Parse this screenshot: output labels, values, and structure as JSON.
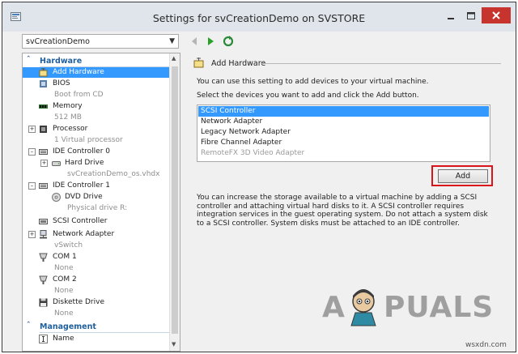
{
  "window": {
    "title": "Settings for svCreationDemo on SVSTORE",
    "icon": "settings-app-icon"
  },
  "toolbar": {
    "vm_selector_value": "svCreationDemo",
    "back_icon": "back-arrow-icon",
    "forward_icon": "play-forward-icon",
    "refresh_icon": "refresh-icon"
  },
  "tree": {
    "hardware_header": "Hardware",
    "management_header": "Management",
    "items": {
      "add_hardware": "Add Hardware",
      "bios": "BIOS",
      "bios_sub": "Boot from CD",
      "memory": "Memory",
      "memory_sub": "512 MB",
      "processor": "Processor",
      "processor_sub": "1 Virtual processor",
      "ide0": "IDE Controller 0",
      "hard_drive": "Hard Drive",
      "hard_drive_sub": "svCreationDemo_os.vhdx",
      "ide1": "IDE Controller 1",
      "dvd_drive": "DVD Drive",
      "dvd_drive_sub": "Physical drive R:",
      "scsi": "SCSI Controller",
      "network": "Network Adapter",
      "network_sub": "vSwitch",
      "com1": "COM 1",
      "com1_sub": "None",
      "com2": "COM 2",
      "com2_sub": "None",
      "diskette": "Diskette Drive",
      "diskette_sub": "None",
      "name": "Name"
    }
  },
  "panel": {
    "title": "Add Hardware",
    "line1": "You can use this setting to add devices to your virtual machine.",
    "line2": "Select the devices you want to add and click the Add button.",
    "devices": [
      {
        "label": "SCSI Controller",
        "state": "selected"
      },
      {
        "label": "Network Adapter",
        "state": "normal"
      },
      {
        "label": "Legacy Network Adapter",
        "state": "normal"
      },
      {
        "label": "Fibre Channel Adapter",
        "state": "normal"
      },
      {
        "label": "RemoteFX 3D Video Adapter",
        "state": "disabled"
      }
    ],
    "add_button": "Add",
    "info_text": "You can increase the storage available to a virtual machine by adding a SCSI controller and attaching virtual hard disks to it. A SCSI controller requires integration services in the guest operating system. Do not attach a system disk to a SCSI controller. System disks must be attached to an IDE controller."
  },
  "watermark": {
    "left": "A",
    "right": "PUALS",
    "site": "wsxdn.com"
  },
  "colors": {
    "selection": "#3399ff",
    "section_header": "#1f5f9e",
    "close_button": "#c7332d",
    "highlight_box": "#d9141a"
  }
}
